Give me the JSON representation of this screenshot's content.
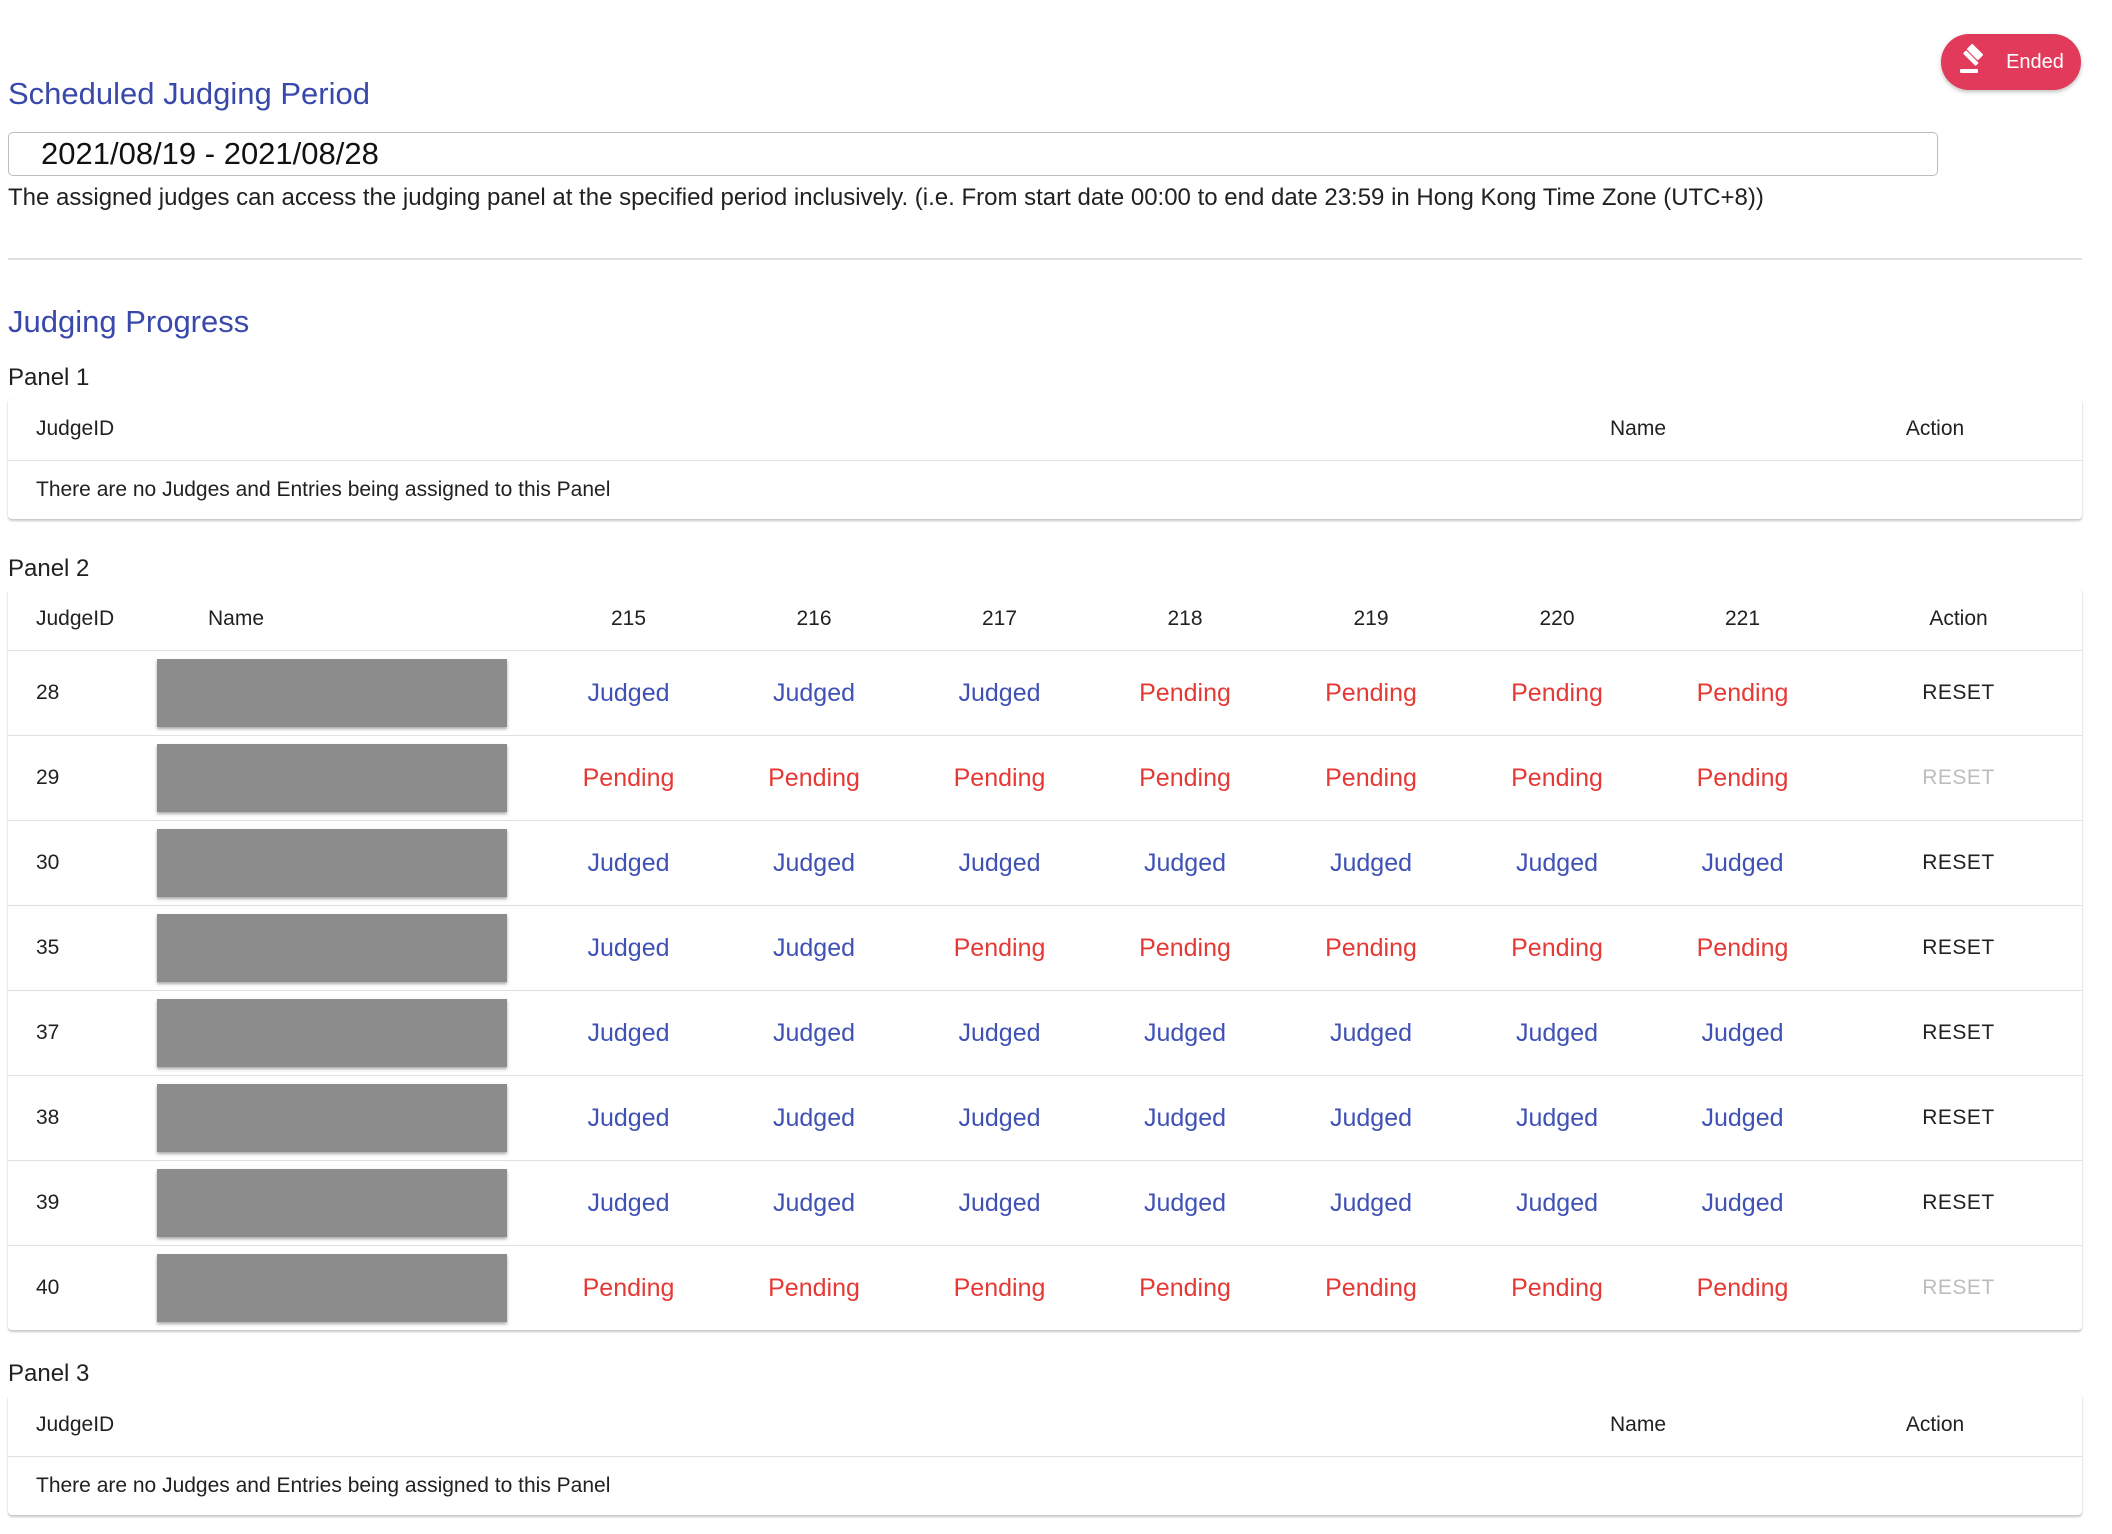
{
  "status": {
    "label": "Ended",
    "icon": "gavel-icon",
    "color": "#e23a5a"
  },
  "schedule": {
    "title": "Scheduled Judging Period",
    "date_range": "2021/08/19 - 2021/08/28",
    "helper": "The assigned judges can access the judging panel at the specified period inclusively. (i.e. From start date 00:00 to end date 23:59 in Hong Kong Time Zone (UTC+8))"
  },
  "progress": {
    "title": "Judging Progress",
    "panel1": {
      "label": "Panel 1",
      "headers": {
        "judge_id": "JudgeID",
        "name": "Name",
        "action": "Action"
      },
      "empty": "There are no Judges and Entries being assigned to this Panel"
    },
    "panel2": {
      "label": "Panel 2",
      "headers": {
        "judge_id": "JudgeID",
        "name": "Name",
        "entries": [
          "215",
          "216",
          "217",
          "218",
          "219",
          "220",
          "221"
        ],
        "action": "Action"
      },
      "reset_label": "RESET",
      "rows": [
        {
          "id": "28",
          "statuses": [
            "Judged",
            "Judged",
            "Judged",
            "Pending",
            "Pending",
            "Pending",
            "Pending"
          ],
          "reset_enabled": true
        },
        {
          "id": "29",
          "statuses": [
            "Pending",
            "Pending",
            "Pending",
            "Pending",
            "Pending",
            "Pending",
            "Pending"
          ],
          "reset_enabled": false
        },
        {
          "id": "30",
          "statuses": [
            "Judged",
            "Judged",
            "Judged",
            "Judged",
            "Judged",
            "Judged",
            "Judged"
          ],
          "reset_enabled": true
        },
        {
          "id": "35",
          "statuses": [
            "Judged",
            "Judged",
            "Pending",
            "Pending",
            "Pending",
            "Pending",
            "Pending"
          ],
          "reset_enabled": true
        },
        {
          "id": "37",
          "statuses": [
            "Judged",
            "Judged",
            "Judged",
            "Judged",
            "Judged",
            "Judged",
            "Judged"
          ],
          "reset_enabled": true
        },
        {
          "id": "38",
          "statuses": [
            "Judged",
            "Judged",
            "Judged",
            "Judged",
            "Judged",
            "Judged",
            "Judged"
          ],
          "reset_enabled": true
        },
        {
          "id": "39",
          "statuses": [
            "Judged",
            "Judged",
            "Judged",
            "Judged",
            "Judged",
            "Judged",
            "Judged"
          ],
          "reset_enabled": true
        },
        {
          "id": "40",
          "statuses": [
            "Pending",
            "Pending",
            "Pending",
            "Pending",
            "Pending",
            "Pending",
            "Pending"
          ],
          "reset_enabled": false
        }
      ]
    },
    "panel3": {
      "label": "Panel 3",
      "headers": {
        "judge_id": "JudgeID",
        "name": "Name",
        "action": "Action"
      },
      "empty": "There are no Judges and Entries being assigned to this Panel"
    }
  },
  "colors": {
    "accent": "#3949ab",
    "judged": "#3f51b5",
    "pending": "#e53935",
    "redaction": "#8c8c8c"
  }
}
